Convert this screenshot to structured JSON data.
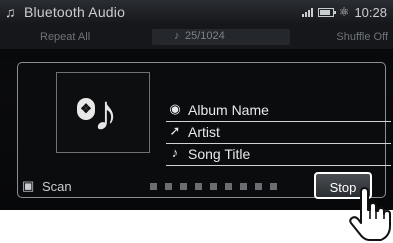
{
  "header": {
    "title": "Bluetooth Audio",
    "source_icon": "bluetooth-source-icon",
    "status": {
      "clock": "10:28",
      "signal_icon": "signal-bars-icon",
      "battery_icon": "battery-icon",
      "bt_icon": "bluetooth-icon"
    }
  },
  "subbar": {
    "repeat": "Repeat All",
    "track_icon": "music-note-icon",
    "track": "25/1024",
    "shuffle": "Shuffle Off"
  },
  "panel": {
    "album_art_icon": "bluetooth-music-icon",
    "album": {
      "icon": "disc-icon",
      "label": "Album Name"
    },
    "artist": {
      "icon": "microphone-icon",
      "label": "Artist"
    },
    "song": {
      "icon": "music-note-icon",
      "label": "Song Title"
    }
  },
  "controls": {
    "scan": {
      "icon": "scan-icon",
      "label": "Scan"
    },
    "progress_dots": 9,
    "stop_label": "Stop"
  },
  "overlay": {
    "hand_icon": "pointing-hand-icon"
  }
}
